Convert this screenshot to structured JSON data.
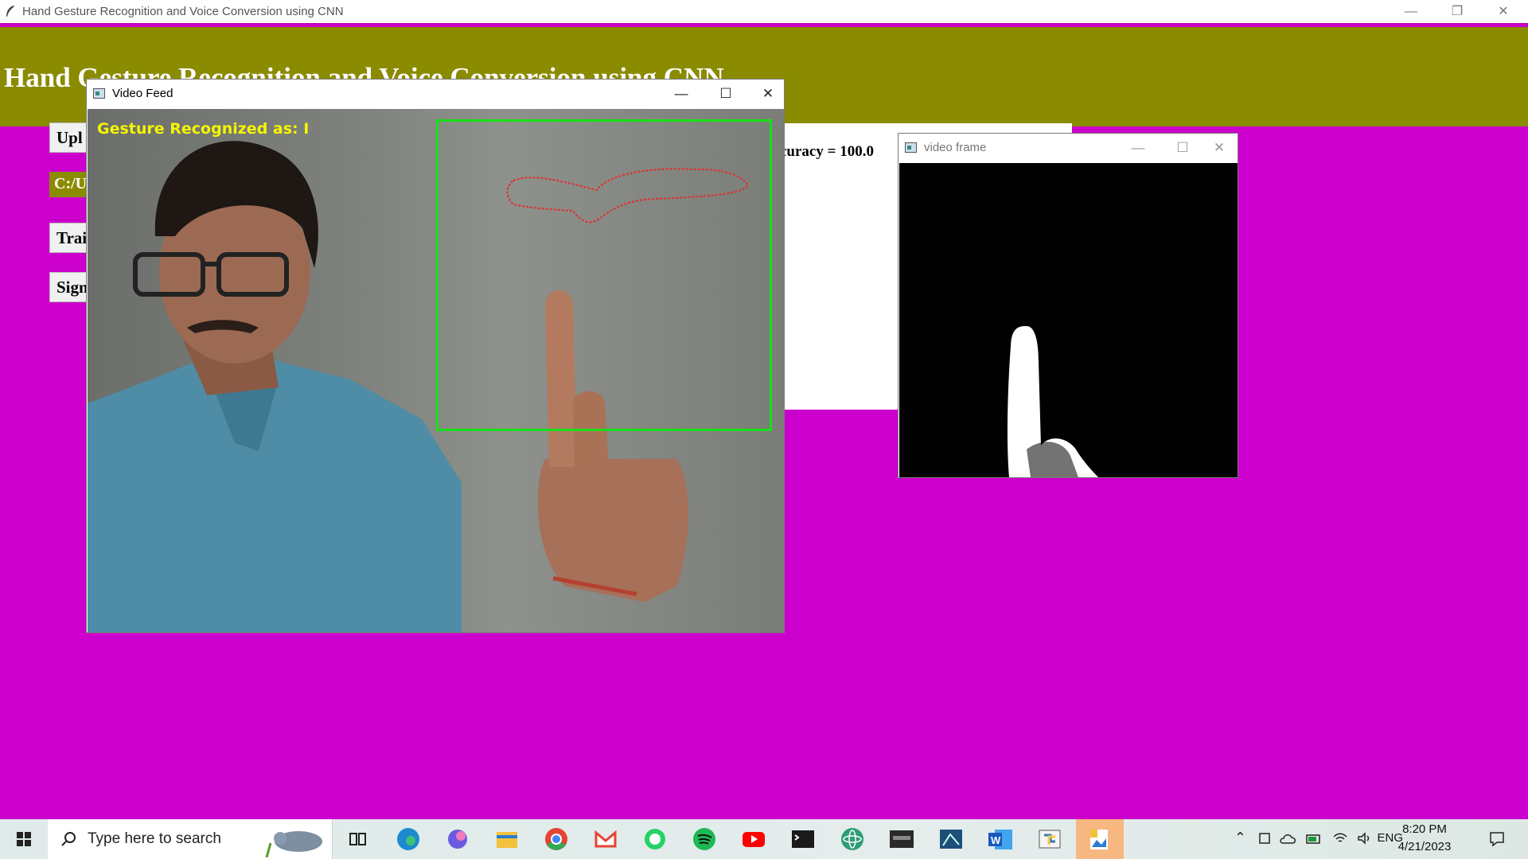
{
  "app": {
    "window_title": "Hand Gesture Recognition and Voice Conversion using CNN",
    "heading": "Hand Gesture Recognition and Voice Conversion using CNN",
    "buttons": [
      "Upl",
      "Trai",
      "Sign"
    ],
    "path_text": "C:/U",
    "accuracy_text": "curacy = 100.0",
    "window_controls": {
      "minimize": "—",
      "restore": "❐",
      "close": "✕"
    }
  },
  "video_feed": {
    "title": "Video Feed",
    "overlay_text": "Gesture Recognized as: I",
    "roi_color": "#17e017",
    "controls": {
      "minimize": "—",
      "maximize": "☐",
      "close": "✕"
    }
  },
  "video_frame": {
    "title": "video frame",
    "controls": {
      "minimize": "—",
      "maximize": "☐",
      "close": "✕"
    }
  },
  "taskbar": {
    "search_placeholder": "Type here to search",
    "pinned_icons": [
      "task-view-icon",
      "edge-icon",
      "copilot-icon",
      "file-explorer-icon",
      "chrome-icon",
      "gmail-icon",
      "whatsapp-icon",
      "spotify-icon",
      "youtube-icon",
      "terminal-icon",
      "atom-icon",
      "mysql-icon",
      "workbench-icon",
      "word-icon",
      "python-icon",
      "photos-icon"
    ],
    "language": "ENG",
    "time": "8:20 PM",
    "date": "4/21/2023"
  },
  "colors": {
    "background": "#cc00cc",
    "header": "#8b8b00",
    "gesture_text": "#f5f500"
  }
}
